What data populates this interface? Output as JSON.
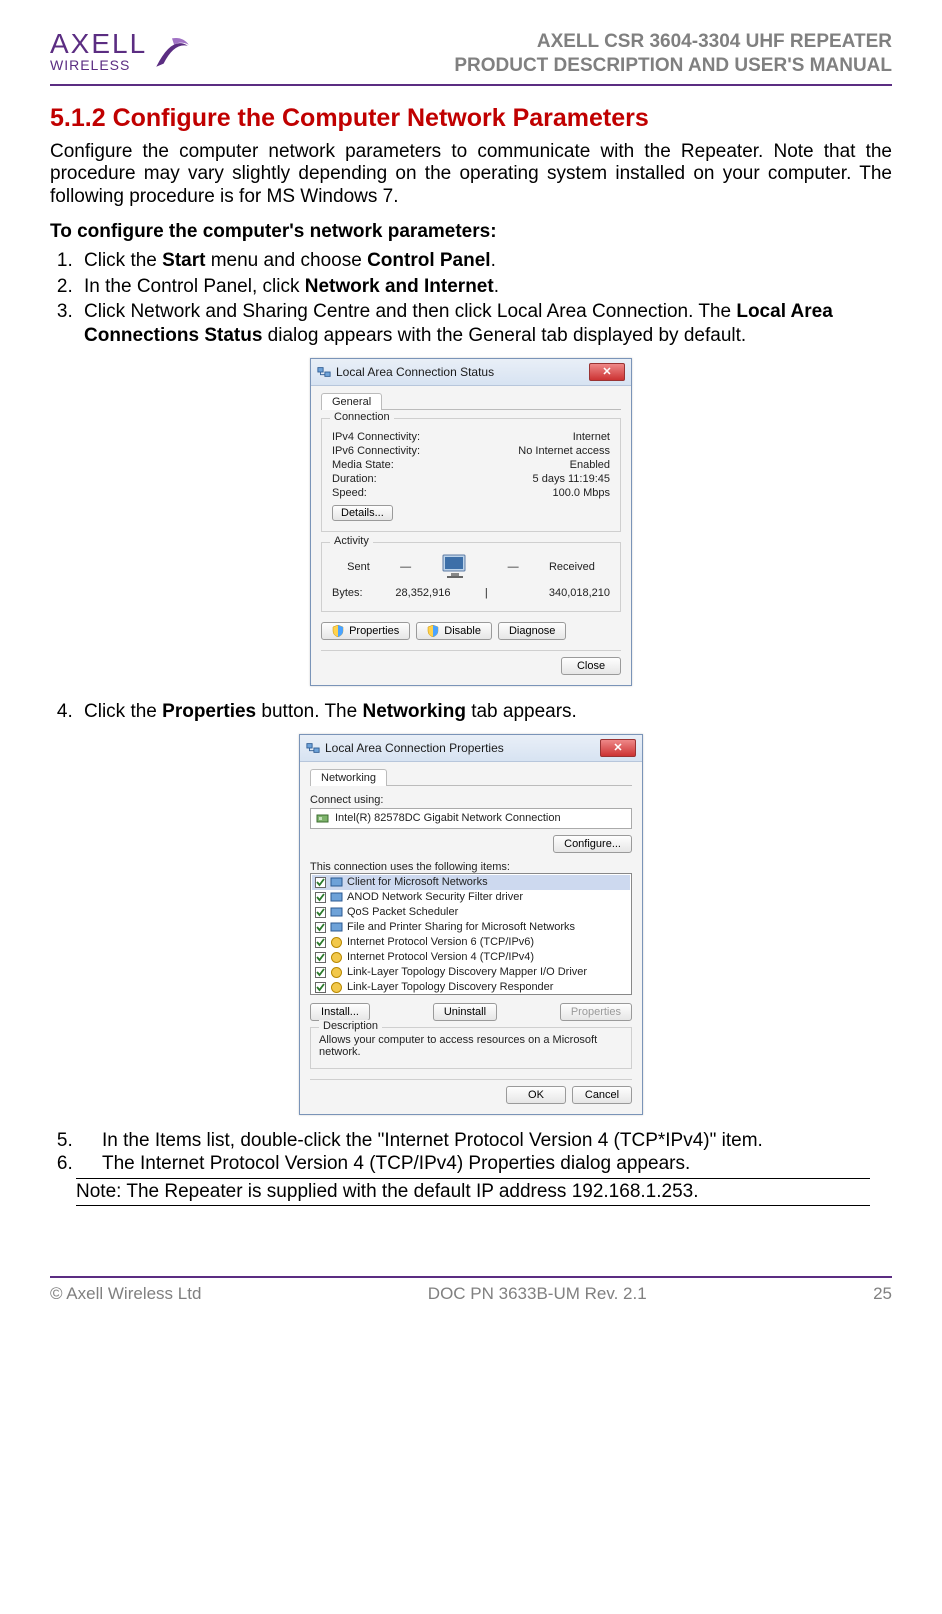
{
  "header": {
    "brand_top": "AXELL",
    "brand_bottom": "WIRELESS",
    "line1": "AXELL CSR 3604-3304 UHF REPEATER",
    "line2": "PRODUCT DESCRIPTION AND USER'S MANUAL"
  },
  "section": {
    "number": "5.1.2",
    "title": "Configure the Computer Network Parameters"
  },
  "intro": "Configure the computer network parameters to communicate with the Repeater. Note that the procedure may vary slightly depending on the operating system installed on your computer. The following procedure is for MS Windows 7.",
  "subheading": "To configure the computer's network parameters:",
  "steps_a": [
    {
      "pre": "Click the ",
      "b1": "Start",
      "mid": " menu and choose ",
      "b2": "Control Panel",
      "post": "."
    },
    {
      "pre": "In the Control Panel, click ",
      "b1": "Network and Internet",
      "post": "."
    },
    {
      "pre": "Click Network and Sharing Centre and then click Local Area Connection. The ",
      "b1": "Local Area Connections Status",
      "post": " dialog appears with the General tab displayed by default."
    }
  ],
  "dialog1": {
    "title": "Local Area Connection Status",
    "tab": "General",
    "group_connection": "Connection",
    "rows": [
      {
        "k": "IPv4 Connectivity:",
        "v": "Internet"
      },
      {
        "k": "IPv6 Connectivity:",
        "v": "No Internet access"
      },
      {
        "k": "Media State:",
        "v": "Enabled"
      },
      {
        "k": "Duration:",
        "v": "5 days 11:19:45"
      },
      {
        "k": "Speed:",
        "v": "100.0 Mbps"
      }
    ],
    "details_btn": "Details...",
    "group_activity": "Activity",
    "sent": "Sent",
    "received": "Received",
    "bytes_label": "Bytes:",
    "bytes_sent": "28,352,916",
    "bytes_recv": "340,018,210",
    "btn_properties": "Properties",
    "btn_disable": "Disable",
    "btn_diagnose": "Diagnose",
    "btn_close": "Close"
  },
  "step4": {
    "pre": "Click the ",
    "b1": "Properties",
    "mid": " button. The ",
    "b2": "Networking",
    "post": " tab appears."
  },
  "dialog2": {
    "title": "Local Area Connection Properties",
    "tab": "Networking",
    "connect_using": "Connect using:",
    "adapter": "Intel(R) 82578DC Gigabit Network Connection",
    "btn_configure": "Configure...",
    "uses_items": "This connection uses the following items:",
    "items": [
      "Client for Microsoft Networks",
      "ANOD Network Security Filter driver",
      "QoS Packet Scheduler",
      "File and Printer Sharing for Microsoft Networks",
      "Internet Protocol Version 6 (TCP/IPv6)",
      "Internet Protocol Version 4 (TCP/IPv4)",
      "Link-Layer Topology Discovery Mapper I/O Driver",
      "Link-Layer Topology Discovery Responder"
    ],
    "btn_install": "Install...",
    "btn_uninstall": "Uninstall",
    "btn_properties": "Properties",
    "desc_label": "Description",
    "desc_text": "Allows your computer to access resources on a Microsoft network.",
    "btn_ok": "OK",
    "btn_cancel": "Cancel"
  },
  "steps_b": [
    "In the Items list, double-click the \"Internet Protocol Version 4 (TCP*IPv4)\" item.",
    "The Internet Protocol Version 4 (TCP/IPv4) Properties dialog appears."
  ],
  "note": "Note:  The Repeater is supplied with the default IP address 192.168.1.253.",
  "footer": {
    "left": "© Axell Wireless Ltd",
    "center": "DOC PN 3633B-UM Rev. 2.1",
    "right": "25"
  }
}
